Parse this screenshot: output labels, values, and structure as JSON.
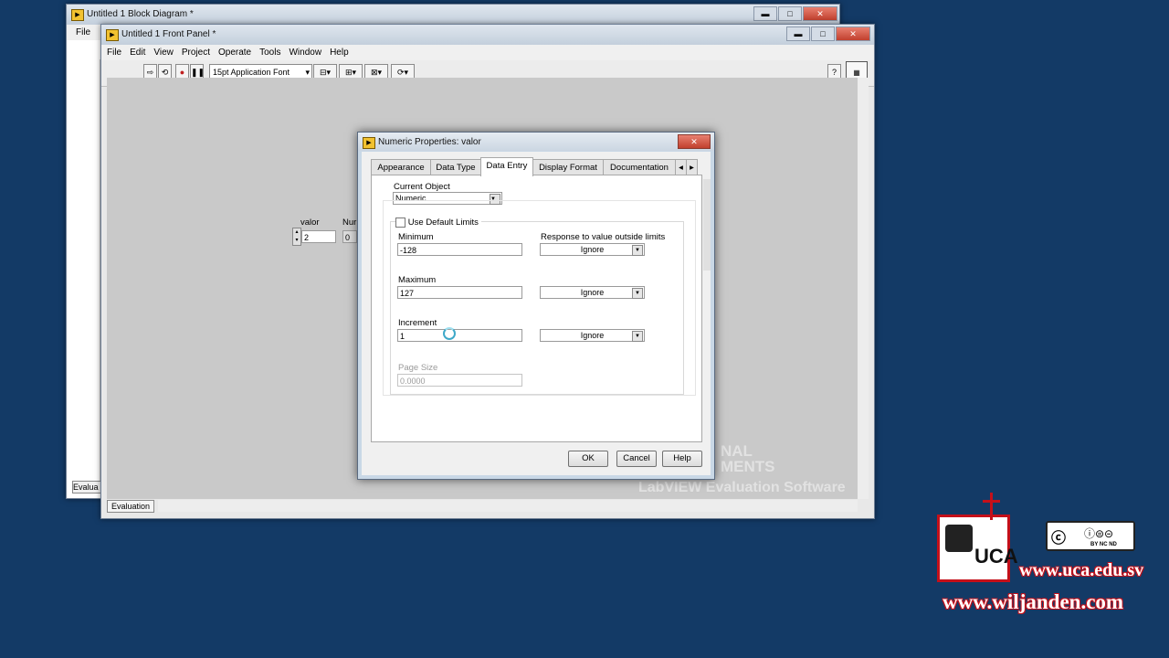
{
  "block_diagram": {
    "title": "Untitled 1 Block Diagram *",
    "menu_file": "File",
    "status_label": "Evalua"
  },
  "front_panel": {
    "title": "Untitled 1 Front Panel *",
    "menu": [
      "File",
      "Edit",
      "View",
      "Project",
      "Operate",
      "Tools",
      "Window",
      "Help"
    ],
    "font_selector": "15pt Application Font",
    "control_label": "valor",
    "control_value": "2",
    "indicator_label": "Nur",
    "indicator_value": "0",
    "watermark_line1": "NAL",
    "watermark_line2": "MENTS",
    "watermark_line3": "LabVIEW  Evaluation Software",
    "status_label": "Evaluation",
    "window_controls": {
      "minimize": "▬",
      "maximize": "□",
      "close": "✕"
    }
  },
  "dialog": {
    "title": "Numeric Properties: valor",
    "close": "✕",
    "tabs": [
      "Appearance",
      "Data Type",
      "Data Entry",
      "Display Format",
      "Documentation"
    ],
    "active_tab": "Data Entry",
    "current_object_label": "Current Object",
    "current_object_value": "Numeric",
    "use_default_limits": "Use Default Limits",
    "response_label": "Response to value outside limits",
    "minimum_label": "Minimum",
    "minimum_value": "-128",
    "maximum_label": "Maximum",
    "maximum_value": "127",
    "increment_label": "Increment",
    "increment_value": "1",
    "page_size_label": "Page Size",
    "page_size_value": "0.0000",
    "response_min": "Ignore",
    "response_max": "Ignore",
    "response_inc": "Ignore",
    "ok": "OK",
    "cancel": "Cancel",
    "help": "Help"
  },
  "branding": {
    "site1": "www.uca.edu.sv",
    "site2": "www.wiljanden.com",
    "cc_text": "BY  NC  ND",
    "logo_text": "UCA"
  },
  "colors": {
    "desktop": "#133a66",
    "panel_bg": "#c9c9c9",
    "brand_red": "#c4101a"
  }
}
